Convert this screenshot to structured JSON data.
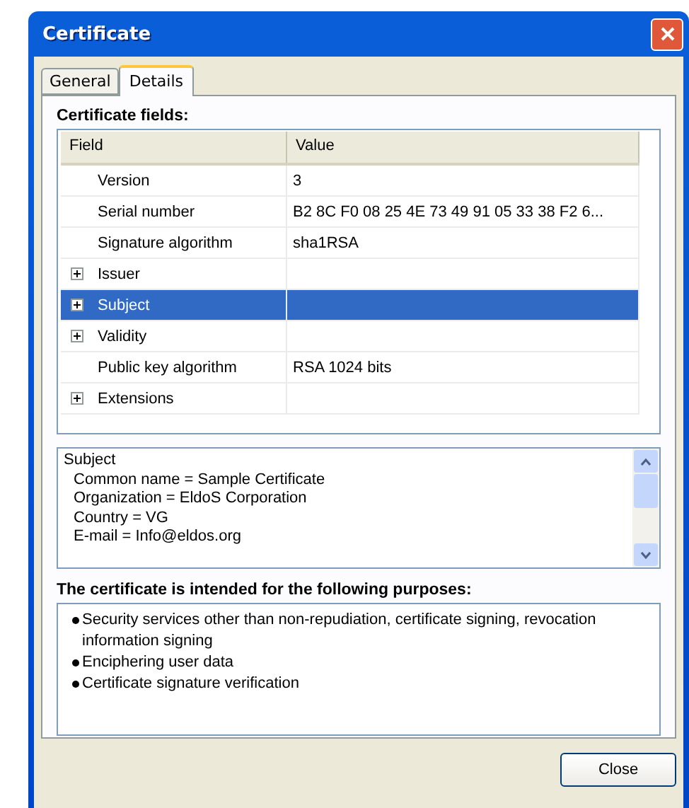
{
  "window": {
    "title": "Certificate"
  },
  "tabs": [
    {
      "label": "General",
      "selected": false
    },
    {
      "label": "Details",
      "selected": true
    }
  ],
  "fields_label": "Certificate fields:",
  "table": {
    "columns": [
      "Field",
      "Value"
    ],
    "rows": [
      {
        "field": "Version",
        "value": "3",
        "expandable": false,
        "selected": false
      },
      {
        "field": "Serial number",
        "value": "B2 8C F0 08 25 4E 73 49 91 05 33 38 F2 6...",
        "expandable": false,
        "selected": false
      },
      {
        "field": "Signature algorithm",
        "value": "sha1RSA",
        "expandable": false,
        "selected": false
      },
      {
        "field": "Issuer",
        "expandable": true,
        "selected": false
      },
      {
        "field": "Subject",
        "expandable": true,
        "selected": true
      },
      {
        "field": "Validity",
        "expandable": true,
        "selected": false
      },
      {
        "field": "Public key algorithm",
        "value": "RSA 1024 bits",
        "expandable": false,
        "selected": false
      },
      {
        "field": "Extensions",
        "expandable": true,
        "selected": false
      }
    ]
  },
  "details": {
    "title": "Subject",
    "lines": [
      "Common name = Sample Certificate",
      "Organization = EldoS Corporation",
      "Country = VG",
      "E-mail = Info@eldos.org"
    ]
  },
  "purposes_label": "The certificate is intended for the following purposes:",
  "purposes": [
    "Security services other than non-repudiation, certificate signing, revocation information signing",
    "Enciphering user data",
    "Certificate signature verification"
  ],
  "close_button": "Close"
}
